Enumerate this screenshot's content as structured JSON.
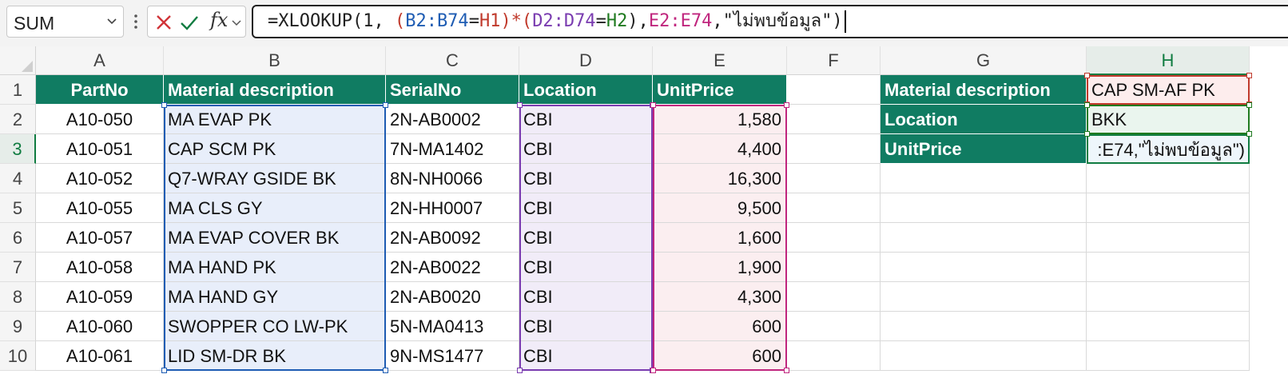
{
  "formula_bar": {
    "name_box": "SUM",
    "cancel_icon": "x-icon",
    "enter_icon": "check-icon",
    "fx_label": "fx",
    "formula_parts": {
      "p1": "=XLOOKUP(1, ",
      "p2": "(",
      "p3": "B2:B74",
      "p4": "=",
      "p5": "H1",
      "p6": ")*(",
      "p7": "D2:D74",
      "p8": "=",
      "p9": "H2",
      "p10": "),",
      "p11": "E2:E74",
      "p12": ",\"ไม่พบข้อมูล\")"
    }
  },
  "columns": [
    "A",
    "B",
    "C",
    "D",
    "E",
    "F",
    "G",
    "H"
  ],
  "rows": [
    "1",
    "2",
    "3",
    "4",
    "5",
    "6",
    "7",
    "8",
    "9",
    "10"
  ],
  "table": {
    "headers": [
      "PartNo",
      "Material description",
      "SerialNo",
      "Location",
      "UnitPrice"
    ],
    "rows": [
      [
        "A10-050",
        "MA EVAP PK",
        "2N-AB0002",
        "CBI",
        "1,580"
      ],
      [
        "A10-051",
        "CAP SCM PK",
        "7N-MA1402",
        "CBI",
        "4,400"
      ],
      [
        "A10-052",
        "Q7-WRAY GSIDE BK",
        "8N-NH0066",
        "CBI",
        "16,300"
      ],
      [
        "A10-055",
        "MA CLS GY",
        "2N-HH0007",
        "CBI",
        "9,500"
      ],
      [
        "A10-057",
        "MA EVAP COVER BK",
        "2N-AB0092",
        "CBI",
        "1,600"
      ],
      [
        "A10-058",
        "MA HAND PK",
        "2N-AB0022",
        "CBI",
        "1,900"
      ],
      [
        "A10-059",
        "MA HAND GY",
        "2N-AB0020",
        "CBI",
        "4,300"
      ],
      [
        "A10-060",
        "SWOPPER CO LW-PK",
        "5N-MA0413",
        "CBI",
        "600"
      ],
      [
        "A10-061",
        "LID SM-DR BK",
        "9N-MS1477",
        "CBI",
        "600"
      ]
    ]
  },
  "lookup_panel": {
    "labels": [
      "Material description",
      "Location",
      "UnitPrice"
    ],
    "values": [
      "CAP SM-AF PK",
      "BKK",
      ":E74,\"ไม่พบข้อมูล\")"
    ]
  },
  "colors": {
    "header_fill": "#107c62",
    "ref_blue": "#1e5cb3",
    "ref_purple": "#7a3cb0",
    "ref_magenta": "#c0267e",
    "ref_red": "#c0392b",
    "ref_green": "#1f7a1f"
  }
}
